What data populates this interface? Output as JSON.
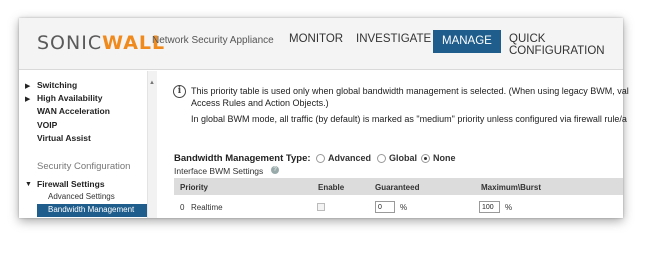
{
  "header": {
    "logo_part1": "SONIC",
    "logo_part2": "WALL",
    "subtitle": "Network Security Appliance",
    "nav": [
      "MONITOR",
      "INVESTIGATE",
      "MANAGE",
      "QUICK CONFIGURATION"
    ],
    "active_nav": "MANAGE"
  },
  "sidebar": {
    "items": [
      {
        "label": "Switching",
        "arrow": "▶"
      },
      {
        "label": "High Availability",
        "arrow": "▶"
      },
      {
        "label": "WAN Acceleration"
      },
      {
        "label": "VOIP"
      },
      {
        "label": "Virtual Assist"
      }
    ],
    "section_title": "Security Configuration",
    "firewall_label": "Firewall Settings",
    "firewall_arrow": "▼",
    "sub_items": [
      "Advanced Settings",
      "Bandwidth Management"
    ],
    "selected": "Bandwidth Management"
  },
  "info": {
    "line1": "This priority table is used only when global bandwidth management is selected. (When using legacy BWM, val",
    "line2": "Access Rules and Action Objects.)",
    "line3": "In global BWM mode, all traffic (by default) is marked as \"medium\" priority unless configured via firewall rule/a"
  },
  "bwm": {
    "label": "Bandwidth Management Type:",
    "options": [
      "Advanced",
      "Global",
      "None"
    ],
    "selected": "None",
    "interface_label": "Interface BWM Settings"
  },
  "table": {
    "columns": [
      "Priority",
      "Enable",
      "Guaranteed",
      "Maximum\\Burst"
    ],
    "rows": [
      {
        "index": "0",
        "name": "Realtime",
        "enabled": false,
        "guaranteed": "0",
        "guaranteed_unit": "%",
        "max": "100",
        "max_unit": "%"
      }
    ]
  }
}
